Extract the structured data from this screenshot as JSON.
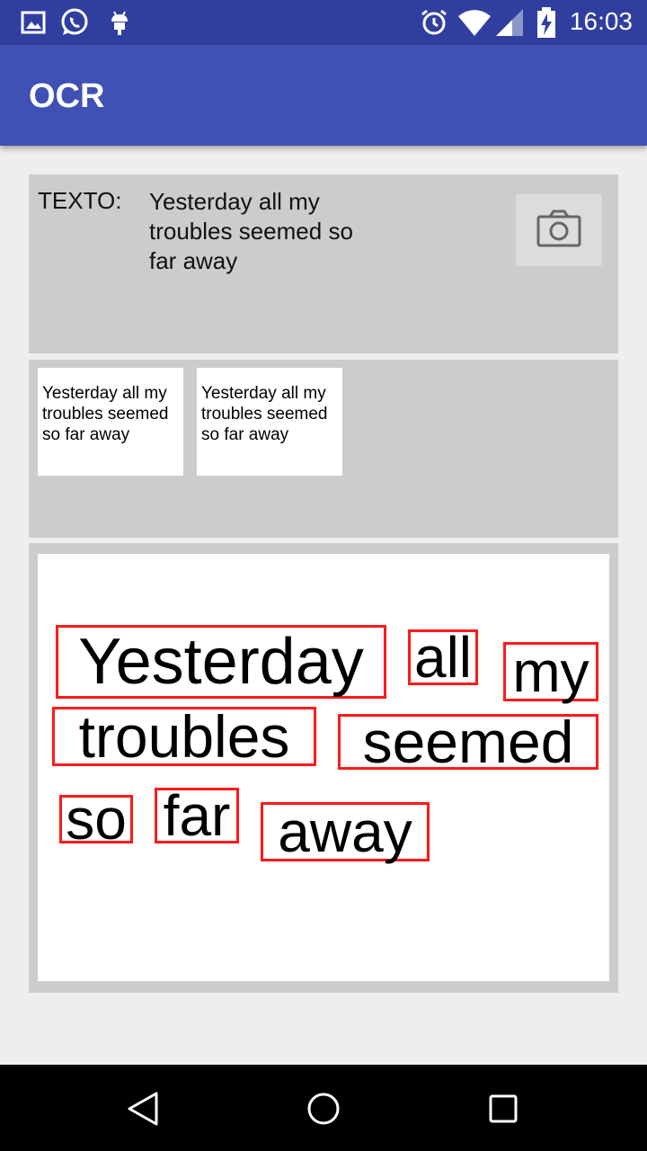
{
  "status_bar": {
    "time": "16:03",
    "left_icons": [
      "image-icon",
      "whatsapp-icon",
      "android-debug-icon"
    ],
    "right_icons": [
      "alarm-icon",
      "wifi-icon",
      "cellular-signal-icon",
      "battery-charging-icon"
    ]
  },
  "app_bar": {
    "title": "OCR"
  },
  "text_panel": {
    "label": "TEXTO:",
    "value": "Yesterday all my troubles seemed so far away",
    "camera_button_icon": "camera-icon"
  },
  "thumbnails": [
    {
      "text": "Yesterday all my troubles seemed so far away"
    },
    {
      "text": "Yesterday all my troubles seemed so far away"
    }
  ],
  "detected_words": [
    "Yesterday",
    "all",
    "my",
    "troubles",
    "seemed",
    "so",
    "far",
    "away"
  ],
  "colors": {
    "status_bar": "#303f9f",
    "app_bar": "#3f51b5",
    "panel_bg": "#cccccc",
    "page_bg": "#eeeeee",
    "bounding_box": "#ff1a1a",
    "nav_bar": "#000000"
  },
  "nav_bar": {
    "icons": [
      "back-icon",
      "home-icon",
      "recents-icon"
    ]
  }
}
